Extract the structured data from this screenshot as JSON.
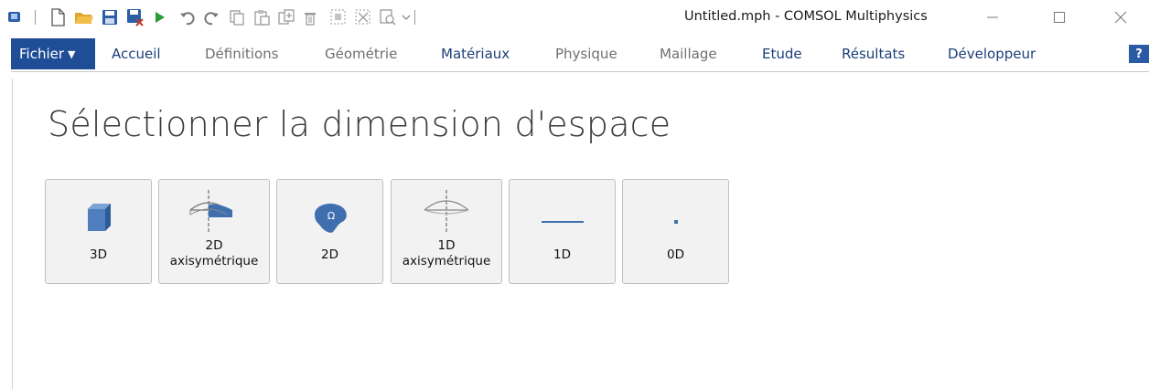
{
  "window": {
    "title": "Untitled.mph - COMSOL Multiphysics"
  },
  "toolbar": {
    "icons": [
      "app-logo",
      "new-file",
      "open-folder",
      "save",
      "save-as",
      "run",
      "undo",
      "redo",
      "copy",
      "paste",
      "duplicate",
      "delete",
      "select-box",
      "deselect",
      "find",
      "dropdown"
    ]
  },
  "ribbon": {
    "file_label": "Fichier",
    "help_label": "?",
    "tabs": [
      {
        "label": "Accueil",
        "state": "active"
      },
      {
        "label": "Définitions",
        "state": "muted"
      },
      {
        "label": "Géométrie",
        "state": "muted"
      },
      {
        "label": "Matériaux",
        "state": "active"
      },
      {
        "label": "Physique",
        "state": "muted"
      },
      {
        "label": "Maillage",
        "state": "muted"
      },
      {
        "label": "Etude",
        "state": "active"
      },
      {
        "label": "Résultats",
        "state": "active"
      },
      {
        "label": "Développeur",
        "state": "active"
      }
    ]
  },
  "main": {
    "title": "Sélectionner la dimension d'espace",
    "dimensions": [
      {
        "id": "3d",
        "line1": "3D",
        "line2": ""
      },
      {
        "id": "2d-axi",
        "line1": "2D",
        "line2": "axisymétrique"
      },
      {
        "id": "2d",
        "line1": "2D",
        "line2": ""
      },
      {
        "id": "1d-axi",
        "line1": "1D",
        "line2": "axisymétrique"
      },
      {
        "id": "1d",
        "line1": "1D",
        "line2": ""
      },
      {
        "id": "0d",
        "line1": "0D",
        "line2": ""
      }
    ]
  },
  "colors": {
    "file_bg": "#1f4e96",
    "icon_blue": "#3f6fae",
    "button_bg": "#f2f2f2"
  }
}
